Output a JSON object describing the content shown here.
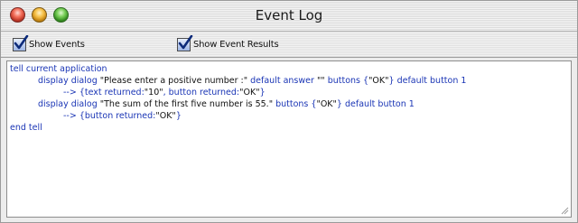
{
  "window": {
    "title": "Event Log"
  },
  "toolbar": {
    "show_events_label": "Show Events",
    "show_events_checked": true,
    "show_event_results_label": "Show Event Results",
    "show_event_results_checked": true
  },
  "log": {
    "line1": "tell current application",
    "line2": [
      {
        "t": "display dialog ",
        "k": "kw"
      },
      {
        "t": "\"Please enter a positive number :\"",
        "k": "str"
      },
      {
        "t": " default answer ",
        "k": "kw"
      },
      {
        "t": "\"\"",
        "k": "str"
      },
      {
        "t": " buttons {",
        "k": "kw"
      },
      {
        "t": "\"OK\"",
        "k": "str"
      },
      {
        "t": "} default button 1",
        "k": "kw"
      }
    ],
    "line3": [
      {
        "t": "--> {text returned:",
        "k": "kw"
      },
      {
        "t": "\"10\"",
        "k": "str"
      },
      {
        "t": ", button returned:",
        "k": "kw"
      },
      {
        "t": "\"OK\"",
        "k": "str"
      },
      {
        "t": "}",
        "k": "kw"
      }
    ],
    "line4": [
      {
        "t": "display dialog ",
        "k": "kw"
      },
      {
        "t": "\"The sum of the first five number is 55.\"",
        "k": "str"
      },
      {
        "t": " buttons {",
        "k": "kw"
      },
      {
        "t": "\"OK\"",
        "k": "str"
      },
      {
        "t": "} default button 1",
        "k": "kw"
      }
    ],
    "line5": [
      {
        "t": "--> {button returned:",
        "k": "kw"
      },
      {
        "t": "\"OK\"",
        "k": "str"
      },
      {
        "t": "}",
        "k": "kw"
      }
    ],
    "line6": "end tell"
  }
}
